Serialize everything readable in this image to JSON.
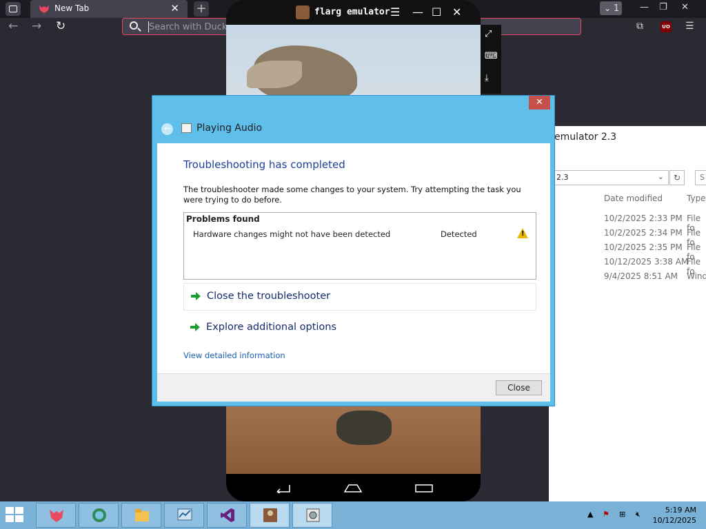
{
  "browser": {
    "tab_title": "New Tab",
    "tab_close": "✕",
    "new_tab": "+",
    "tab_count": "1",
    "search_placeholder": "Search with DuckDuckGo or enter address",
    "extension_label": "UO"
  },
  "emulator": {
    "title": "flarg emulator"
  },
  "explorer": {
    "title": "emulator 2.3",
    "address": "2.3",
    "search_hint": "S",
    "headers": {
      "date": "Date modified",
      "type": "Type"
    },
    "rows": [
      {
        "date": "10/2/2025 2:33 PM",
        "type": "File fo"
      },
      {
        "date": "10/2/2025 2:34 PM",
        "type": "File fo"
      },
      {
        "date": "10/2/2025 2:35 PM",
        "type": "File fo"
      },
      {
        "date": "10/12/2025 3:38 AM",
        "type": "File fo"
      },
      {
        "date": "9/4/2025 8:51 AM",
        "type": "Wind"
      }
    ]
  },
  "dialog": {
    "app_title": "Playing Audio",
    "close_x": "✕",
    "heading": "Troubleshooting has completed",
    "message": "The troubleshooter made some changes to your system. Try attempting the task you were trying to do before.",
    "problems_header": "Problems found",
    "problem": {
      "description": "Hardware changes might not have been detected",
      "status": "Detected"
    },
    "options": [
      "Close the troubleshooter",
      "Explore additional options"
    ],
    "detail_link": "View detailed information",
    "close_button": "Close",
    "colors": {
      "frame": "#5fbfea",
      "heading": "#1a3e9a",
      "arrow": "#1a9e2e"
    }
  },
  "taskbar": {
    "time": "5:19 AM",
    "date": "10/12/2025",
    "apps": [
      "firefox",
      "network-globe",
      "file-explorer",
      "system-monitor",
      "visual-studio",
      "flarg-emulator",
      "troubleshooter"
    ]
  }
}
